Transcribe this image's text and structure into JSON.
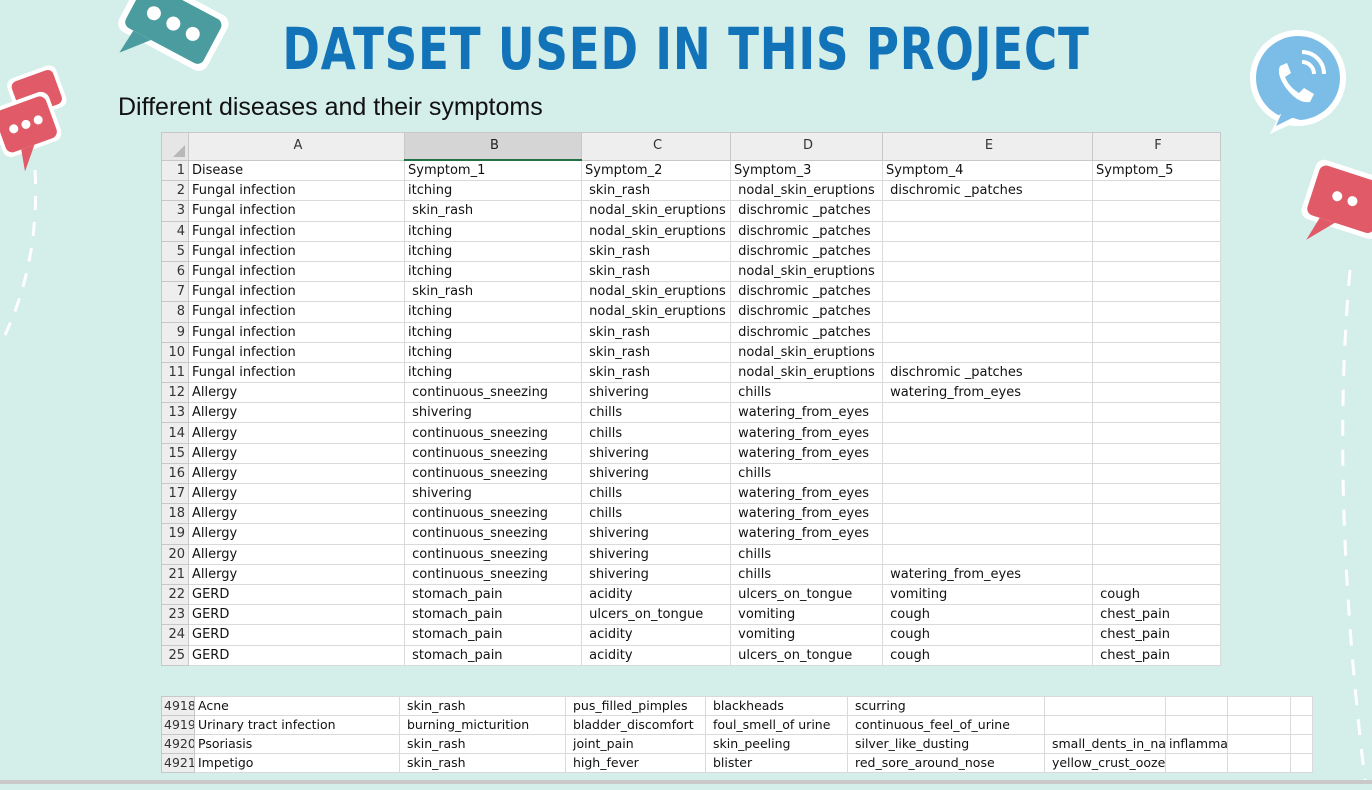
{
  "slide": {
    "title": "DATSET USED IN THIS PROJECT",
    "subtitle": "Different diseases and their symptoms"
  },
  "colors": {
    "background": "#d4eeea",
    "title": "#1273b8",
    "chat_teal": "#4a9c9e",
    "chat_red": "#e05a68",
    "phone_blue": "#7bbde6"
  },
  "icons": [
    "chat-bubble-teal-icon",
    "chat-bubble-red-icon",
    "phone-bubble-icon",
    "chat-bubble-red-right-icon"
  ],
  "sheet": {
    "columns": [
      "A",
      "B",
      "C",
      "D",
      "E",
      "F"
    ],
    "rows": [
      {
        "num": "1",
        "cells": [
          "Disease",
          "Symptom_1",
          "Symptom_2",
          "Symptom_3",
          "Symptom_4",
          "Symptom_5"
        ]
      },
      {
        "num": "2",
        "cells": [
          "Fungal infection",
          "itching",
          " skin_rash",
          " nodal_skin_eruptions",
          " dischromic _patches",
          ""
        ]
      },
      {
        "num": "3",
        "cells": [
          "Fungal infection",
          " skin_rash",
          " nodal_skin_eruptions",
          " dischromic _patches",
          "",
          ""
        ]
      },
      {
        "num": "4",
        "cells": [
          "Fungal infection",
          "itching",
          " nodal_skin_eruptions",
          " dischromic _patches",
          "",
          ""
        ]
      },
      {
        "num": "5",
        "cells": [
          "Fungal infection",
          "itching",
          " skin_rash",
          " dischromic _patches",
          "",
          ""
        ]
      },
      {
        "num": "6",
        "cells": [
          "Fungal infection",
          "itching",
          " skin_rash",
          " nodal_skin_eruptions",
          "",
          ""
        ]
      },
      {
        "num": "7",
        "cells": [
          "Fungal infection",
          " skin_rash",
          " nodal_skin_eruptions",
          " dischromic _patches",
          "",
          ""
        ]
      },
      {
        "num": "8",
        "cells": [
          "Fungal infection",
          "itching",
          " nodal_skin_eruptions",
          " dischromic _patches",
          "",
          ""
        ]
      },
      {
        "num": "9",
        "cells": [
          "Fungal infection",
          "itching",
          " skin_rash",
          " dischromic _patches",
          "",
          ""
        ]
      },
      {
        "num": "10",
        "cells": [
          "Fungal infection",
          "itching",
          " skin_rash",
          " nodal_skin_eruptions",
          "",
          ""
        ]
      },
      {
        "num": "11",
        "cells": [
          "Fungal infection",
          "itching",
          " skin_rash",
          " nodal_skin_eruptions",
          " dischromic _patches",
          ""
        ]
      },
      {
        "num": "12",
        "cells": [
          "Allergy",
          " continuous_sneezing",
          " shivering",
          " chills",
          " watering_from_eyes",
          ""
        ]
      },
      {
        "num": "13",
        "cells": [
          "Allergy",
          " shivering",
          " chills",
          " watering_from_eyes",
          "",
          ""
        ]
      },
      {
        "num": "14",
        "cells": [
          "Allergy",
          " continuous_sneezing",
          " chills",
          " watering_from_eyes",
          "",
          ""
        ]
      },
      {
        "num": "15",
        "cells": [
          "Allergy",
          " continuous_sneezing",
          " shivering",
          " watering_from_eyes",
          "",
          ""
        ]
      },
      {
        "num": "16",
        "cells": [
          "Allergy",
          " continuous_sneezing",
          " shivering",
          " chills",
          "",
          ""
        ]
      },
      {
        "num": "17",
        "cells": [
          "Allergy",
          " shivering",
          " chills",
          " watering_from_eyes",
          "",
          ""
        ]
      },
      {
        "num": "18",
        "cells": [
          "Allergy",
          " continuous_sneezing",
          " chills",
          " watering_from_eyes",
          "",
          ""
        ]
      },
      {
        "num": "19",
        "cells": [
          "Allergy",
          " continuous_sneezing",
          " shivering",
          " watering_from_eyes",
          "",
          ""
        ]
      },
      {
        "num": "20",
        "cells": [
          "Allergy",
          " continuous_sneezing",
          " shivering",
          " chills",
          "",
          ""
        ]
      },
      {
        "num": "21",
        "cells": [
          "Allergy",
          " continuous_sneezing",
          " shivering",
          " chills",
          " watering_from_eyes",
          ""
        ]
      },
      {
        "num": "22",
        "cells": [
          "GERD",
          " stomach_pain",
          " acidity",
          " ulcers_on_tongue",
          " vomiting",
          " cough"
        ]
      },
      {
        "num": "23",
        "cells": [
          "GERD",
          " stomach_pain",
          " ulcers_on_tongue",
          " vomiting",
          " cough",
          " chest_pain"
        ]
      },
      {
        "num": "24",
        "cells": [
          "GERD",
          " stomach_pain",
          " acidity",
          " vomiting",
          " cough",
          " chest_pain"
        ]
      },
      {
        "num": "25",
        "cells": [
          "GERD",
          " stomach_pain",
          " acidity",
          " ulcers_on_tongue",
          " cough",
          " chest_pain"
        ]
      }
    ]
  },
  "sheet2": {
    "rows": [
      {
        "num": "4918",
        "cells": [
          "Acne",
          " skin_rash",
          " pus_filled_pimples",
          " blackheads",
          " scurring",
          "",
          "",
          "",
          ""
        ]
      },
      {
        "num": "4919",
        "cells": [
          "Urinary tract infection",
          " burning_micturition",
          " bladder_discomfort",
          " foul_smell_of urine",
          " continuous_feel_of_urine",
          "",
          "",
          "",
          ""
        ]
      },
      {
        "num": "4920",
        "cells": [
          "Psoriasis",
          " skin_rash",
          " joint_pain",
          " skin_peeling",
          " silver_like_dusting",
          " small_dents_in_nai",
          "inflammatory_nails",
          "",
          ""
        ]
      },
      {
        "num": "4921",
        "cells": [
          "Impetigo",
          " skin_rash",
          " high_fever",
          " blister",
          " red_sore_around_nose",
          " yellow_crust_ooze",
          "",
          "",
          ""
        ]
      }
    ]
  }
}
